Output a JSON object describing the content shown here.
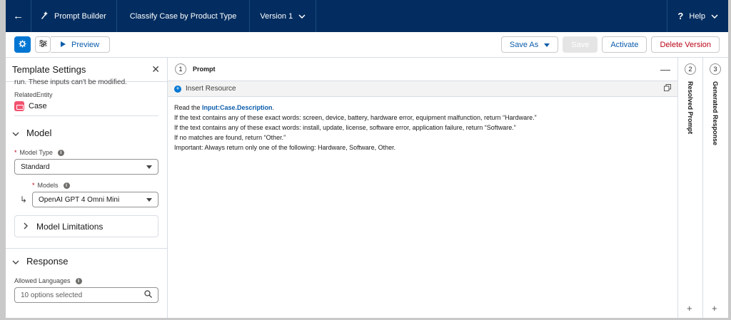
{
  "topbar": {
    "back_icon": "back-arrow-icon",
    "app_name": "Prompt Builder",
    "template_title": "Classify Case by Product Type",
    "version": "Version 1",
    "help_label": "Help"
  },
  "toolbar": {
    "preview_label": "Preview",
    "save_as_label": "Save As",
    "save_label": "Save",
    "activate_label": "Activate",
    "delete_label": "Delete Version"
  },
  "left_panel": {
    "title": "Template Settings",
    "truncated_text": "run. These inputs can't be modified.",
    "related_entity_label": "RelatedEntity",
    "related_entity_value": "Case",
    "model_section": "Model",
    "model_type_label": "Model Type",
    "model_type_value": "Standard",
    "models_label": "Models",
    "models_value": "OpenAI GPT 4 Omni Mini",
    "model_limitations": "Model Limitations",
    "response_section": "Response",
    "allowed_languages_label": "Allowed Languages",
    "allowed_languages_value": "10 options selected"
  },
  "prompt_pane": {
    "number": "1",
    "title": "Prompt",
    "insert_resource": "Insert Resource",
    "line1_prefix": "Read the ",
    "line1_merge": "Input:Case.Description",
    "line1_suffix": ".",
    "line2": "If the text contains any of these exact words: screen, device, battery, hardware error, equipment malfunction, return “Hardware.”",
    "line3": "If the text contains any of these exact words: install, update, license, software error, application failure, return “Software.”",
    "line4": "If no matches are found, return “Other.”",
    "line5": "Important: Always return only one of the following: Hardware, Software, Other."
  },
  "resolved_pane": {
    "number": "2",
    "title": "Resolved Prompt"
  },
  "generated_pane": {
    "number": "3",
    "title": "Generated Response"
  },
  "colors": {
    "topbar": "#032d60",
    "brand_blue": "#0176d3",
    "danger": "#ba0517",
    "case_icon": "#f2536f"
  }
}
